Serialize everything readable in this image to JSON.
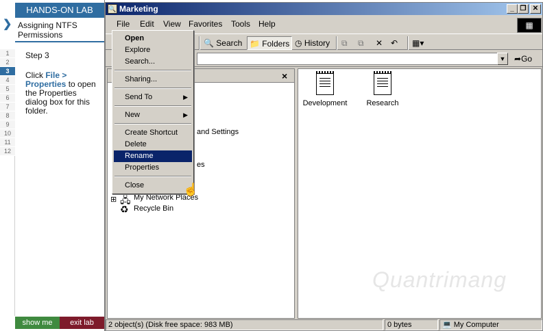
{
  "lab": {
    "header": "HANDS-ON LAB",
    "title": "Assigning NTFS Permissions",
    "step_numbers": [
      "1",
      "2",
      "3",
      "4",
      "5",
      "6",
      "7",
      "8",
      "9",
      "10",
      "11",
      "12"
    ],
    "active_step": "3",
    "step_label": "Step 3",
    "instruction_pre": "Click ",
    "instruction_bold": "File > Properties",
    "instruction_post": " to open the Properties dialog box for this folder.",
    "show_me": "show me",
    "exit_lab": "exit lab"
  },
  "window": {
    "title": "Marketing",
    "menu": [
      "File",
      "Edit",
      "View",
      "Favorites",
      "Tools",
      "Help"
    ],
    "toolbar": {
      "search": "Search",
      "folders": "Folders",
      "history": "History"
    },
    "go_label": "Go",
    "tree": {
      "partial_1": "and Settings",
      "partial_2": "es",
      "network_places": "My Network Places",
      "recycle_bin": "Recycle Bin"
    },
    "files": [
      "Development",
      "Research"
    ],
    "status": {
      "objects": "2 object(s) (Disk free space: 983 MB)",
      "size": "0 bytes",
      "location": "My Computer"
    }
  },
  "context_menu": {
    "items": [
      "Open",
      "Explore",
      "Search...",
      "Sharing...",
      "Send To",
      "New",
      "Create Shortcut",
      "Delete",
      "Rename",
      "Properties",
      "Close"
    ],
    "highlighted": "Rename"
  },
  "watermark": "Quantrimang",
  "colors": {
    "lab_blue": "#2f6da1",
    "title_dark": "#0a246a",
    "show_me_green": "#3f8a3f",
    "exit_lab_red": "#7e1b2b"
  }
}
